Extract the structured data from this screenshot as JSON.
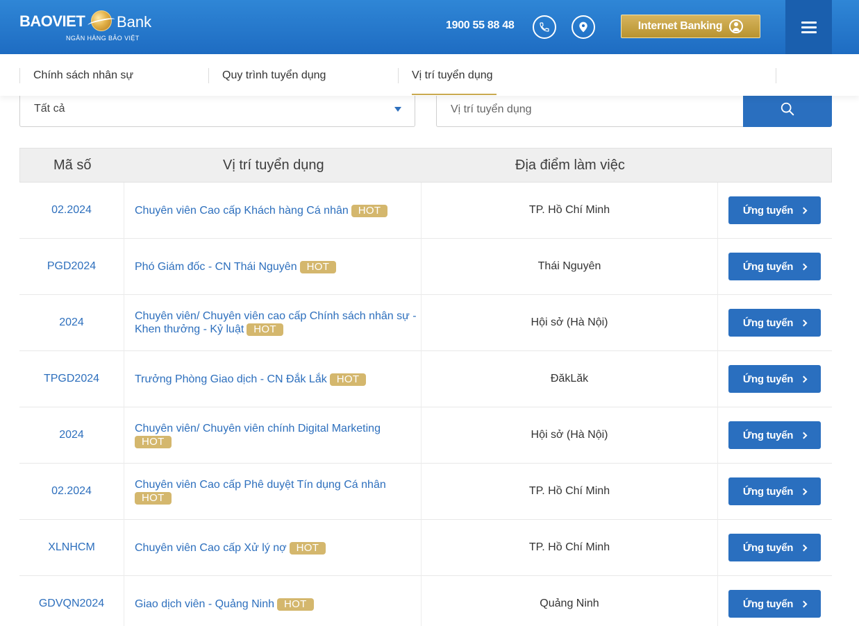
{
  "brand": {
    "name_bold": "BAOVIET",
    "name_light": "Bank",
    "tagline": "NGÂN HÀNG BẢO VIỆT"
  },
  "header": {
    "hotline": "1900 55 88 48",
    "internet_banking_label": "Internet Banking",
    "colors": {
      "primary": "#1e6cc2",
      "gold": "#c9a94f"
    }
  },
  "subnav": {
    "items": [
      {
        "label": "Chính sách nhân sự"
      },
      {
        "label": "Quy trình tuyển dụng"
      },
      {
        "label": "Vị trí tuyển dụng",
        "active": true
      }
    ]
  },
  "filters": {
    "category_value": "Tất cả",
    "search_placeholder": "Vị trí tuyển dụng",
    "search_value": ""
  },
  "table": {
    "headers": [
      "Mã số",
      "Vị trí tuyển dụng",
      "Địa điểm làm việc"
    ],
    "hot_label": "HOT",
    "apply_label": "Ứng tuyển",
    "rows": [
      {
        "code": "02.2024",
        "title": "Chuyên viên Cao cấp Khách hàng Cá nhân",
        "location": "TP. Hồ Chí Minh"
      },
      {
        "code": "PGD2024",
        "title": "Phó Giám đốc - CN Thái Nguyên",
        "location": "Thái Nguyên"
      },
      {
        "code": "2024",
        "title_lines": [
          "Chuyên viên/ Chuyên viên cao cấp Chính sách nhân sự -",
          "Khen thưởng - Kỷ luật"
        ],
        "location": "Hội sở (Hà Nội)"
      },
      {
        "code": "TPGD2024",
        "title": "Trưởng Phòng Giao dịch - CN Đắk Lắk",
        "location": "ĐăkLăk"
      },
      {
        "code": "2024",
        "title": "Chuyên viên/ Chuyên viên chính Digital Marketing",
        "hot_newline": true,
        "location": "Hội sở (Hà Nội)"
      },
      {
        "code": "02.2024",
        "title": "Chuyên viên Cao cấp Phê duyệt Tín dụng Cá nhân",
        "hot_newline": true,
        "location": "TP. Hồ Chí Minh"
      },
      {
        "code": "XLNHCM",
        "title": "Chuyên viên Cao cấp Xử lý nợ",
        "location": "TP. Hồ Chí Minh"
      },
      {
        "code": "GDVQN2024",
        "title": "Giao dịch viên - Quảng Ninh",
        "location": "Quảng Ninh"
      }
    ]
  }
}
